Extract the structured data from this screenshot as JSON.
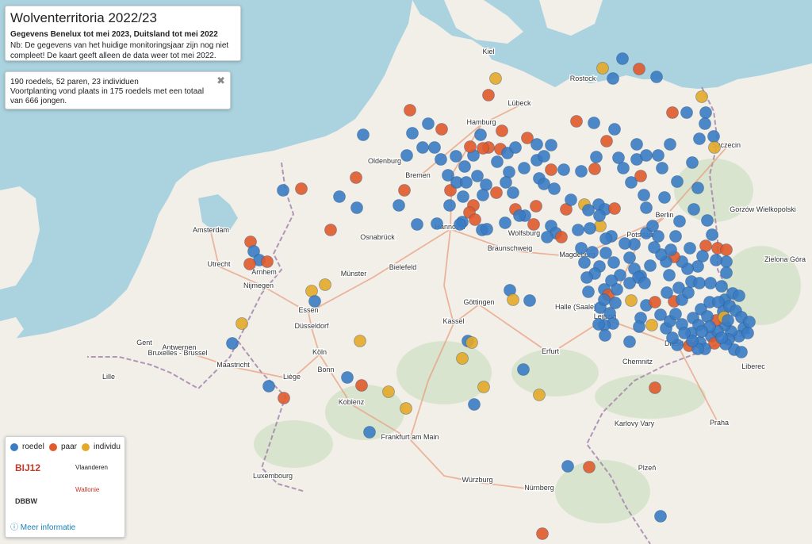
{
  "title": "Wolventerritoria 2022/23",
  "subtitle": "Gegevens Benelux tot mei 2023, Duitsland tot mei 2022",
  "note": "Nb: De gegevens van het huidige monitoringsjaar zijn nog niet compleet! De kaart geeft alleen de data weer tot mei 2022.",
  "stats": {
    "line1": "190 roedels, 52 paren, 23 individuen",
    "line2": "Voortplanting vond plaats in 175 roedels met een totaal van 666 jongen.",
    "close": "✖"
  },
  "legend": {
    "items": [
      {
        "label": "roedel",
        "color": "#3a7cc4"
      },
      {
        "label": "paar",
        "color": "#e05a2b"
      },
      {
        "label": "individu",
        "color": "#e3a928"
      }
    ],
    "logos": [
      "BIJ12",
      "Vlaanderen",
      "DBBW",
      "Wallonie"
    ],
    "more": "ⓘ Meer informatie"
  },
  "colors": {
    "roedel": "#3a7cc4",
    "paar": "#e05a2b",
    "individu": "#e3a928",
    "water": "#aad3df",
    "land": "#f2efe9"
  },
  "places": [
    [
      "Kiel",
      616,
      68
    ],
    [
      "Rostock",
      735,
      102
    ],
    [
      "Hamburg",
      607,
      157
    ],
    [
      "Lübeck",
      655,
      133
    ],
    [
      "Bremen",
      527,
      224
    ],
    [
      "Oldenburg",
      485,
      206
    ],
    [
      "Hannover",
      568,
      289
    ],
    [
      "Berlin",
      838,
      274
    ],
    [
      "Potsdam",
      808,
      299
    ],
    [
      "Magdeburg",
      728,
      324
    ],
    [
      "Leipzig",
      763,
      402
    ],
    [
      "Dresden",
      855,
      436
    ],
    [
      "Halle (Saale)",
      726,
      390
    ],
    [
      "Braunschweig",
      643,
      316
    ],
    [
      "Wolfsburg",
      661,
      297
    ],
    [
      "Osnabrück",
      476,
      302
    ],
    [
      "Bielefeld",
      508,
      340
    ],
    [
      "Münster",
      446,
      348
    ],
    [
      "Essen",
      389,
      394
    ],
    [
      "Düsseldorf",
      393,
      414
    ],
    [
      "Köln",
      403,
      447
    ],
    [
      "Bonn",
      411,
      469
    ],
    [
      "Koblenz",
      443,
      510
    ],
    [
      "Frankfurt am Main",
      517,
      554
    ],
    [
      "Kassel",
      572,
      408
    ],
    [
      "Göttingen",
      604,
      384
    ],
    [
      "Erfurt",
      694,
      446
    ],
    [
      "Würzburg",
      602,
      608
    ],
    [
      "Nürnberg",
      680,
      618
    ],
    [
      "Chemnitz",
      804,
      459
    ],
    [
      "Praha",
      907,
      536
    ],
    [
      "Amsterdam",
      266,
      293
    ],
    [
      "Utrecht",
      276,
      336
    ],
    [
      "Arnhem",
      333,
      346
    ],
    [
      "Nijmegen",
      326,
      363
    ],
    [
      "Antwerpen",
      226,
      441
    ],
    [
      "Bruxelles - Brussel",
      224,
      448
    ],
    [
      "Liège",
      368,
      478
    ],
    [
      "Luxembourg",
      344,
      603
    ],
    [
      "Szczecin",
      916,
      186
    ],
    [
      "Gorzów Wielkopolski",
      962,
      267
    ],
    [
      "Zielona Góra",
      990,
      330
    ],
    [
      "Liberec",
      950,
      465
    ],
    [
      "Karlovy Vary",
      800,
      537
    ],
    [
      "Plzeň",
      816,
      593
    ],
    [
      "Lille",
      137,
      478
    ],
    [
      "Gent",
      182,
      435
    ],
    [
      "Maastricht",
      294,
      463
    ]
  ]
}
